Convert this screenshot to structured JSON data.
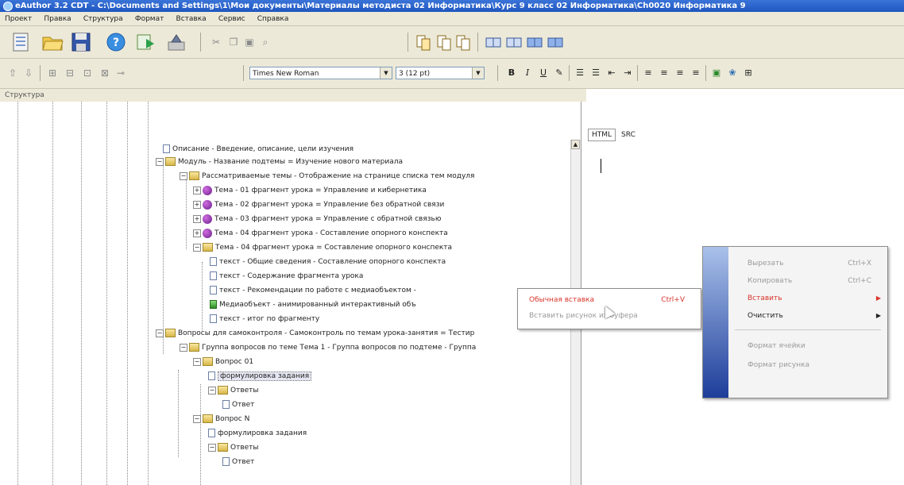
{
  "window": {
    "title": "eAuthor 3.2 CDT - C:\\Documents and Settings\\1\\Мои документы\\Материалы методиста 02 Информатика\\Курс 9 класс 02 Информатика\\Ch0020 Информатика 9"
  },
  "menu": [
    "Проект",
    "Правка",
    "Структура",
    "Формат",
    "Вставка",
    "Сервис",
    "Справка"
  ],
  "toolbar": {
    "font_name": "Times New Roman",
    "font_size": "3 (12 pt)",
    "bold": "B",
    "italic": "I",
    "underline": "U"
  },
  "structure_label": "Структура",
  "tree": [
    {
      "text": "Описание - Введение, описание, цели изучения",
      "icon": "doc"
    },
    {
      "text": "Модуль - Название подтемы = Изучение нового материала",
      "icon": "fold"
    },
    {
      "text": "Рассматриваемые темы - Отображение на странице списка тем модуля",
      "icon": "fold"
    },
    {
      "text": "Тема - 01 фрагмент урока = Управление и кибернетика",
      "icon": "topic"
    },
    {
      "text": "Тема - 02 фрагмент урока = Управление без обратной связи",
      "icon": "topic"
    },
    {
      "text": "Тема - 03 фрагмент урока = Управление с обратной связью",
      "icon": "topic"
    },
    {
      "text": "Тема - 04 фрагмент урока - Составление опорного конспекта",
      "icon": "topic"
    },
    {
      "text": "Тема - 04 фрагмент урока = Составление опорного конспекта",
      "icon": "fold"
    },
    {
      "text": "текст - Общие сведения - Составление опорного конспекта",
      "icon": "doc"
    },
    {
      "text": "текст - Содержание фрагмента урока",
      "icon": "doc"
    },
    {
      "text": "текст - Рекомендации по работе с медиаобъектом -",
      "icon": "doc"
    },
    {
      "text": "Медиаобъект - анимированный интерактивный объ",
      "icon": "media"
    },
    {
      "text": "текст - итог по фрагменту",
      "icon": "doc"
    },
    {
      "text": "Вопросы для самоконтроля - Самоконтроль по темам урока-занятия = Тестир",
      "icon": "fold"
    },
    {
      "text": "Группа вопросов по теме Тема 1 - Группа вопросов по подтеме - Группа",
      "icon": "fold"
    },
    {
      "text": "Вопрос 01",
      "icon": "fold"
    },
    {
      "text": "формулировка задания",
      "icon": "doc"
    },
    {
      "text": "Ответы",
      "icon": "fold"
    },
    {
      "text": "Ответ",
      "icon": "doc"
    },
    {
      "text": "Вопрос N",
      "icon": "fold"
    },
    {
      "text": "формулировка задания",
      "icon": "doc"
    },
    {
      "text": "Ответы",
      "icon": "fold"
    },
    {
      "text": "Ответ",
      "icon": "doc"
    }
  ],
  "editor_tabs": [
    "HTML",
    "SRC"
  ],
  "paste_submenu": {
    "items": [
      {
        "label": "Обычная вставка",
        "shortcut": "Ctrl+V"
      },
      {
        "label": "Вставить рисунок из буфера",
        "shortcut": ""
      }
    ]
  },
  "context_menu": {
    "items": [
      {
        "label": "Вырезать",
        "shortcut": "Ctrl+X"
      },
      {
        "label": "Копировать",
        "shortcut": "Ctrl+C"
      },
      {
        "label": "Вставить",
        "shortcut": ""
      },
      {
        "label": "Очистить",
        "shortcut": ""
      },
      {
        "label": "Формат ячейки",
        "shortcut": ""
      },
      {
        "label": "Формат рисунка",
        "shortcut": ""
      }
    ]
  },
  "colors": {
    "accent_red": "#d9342b",
    "title_blue": "#2a62cc"
  }
}
